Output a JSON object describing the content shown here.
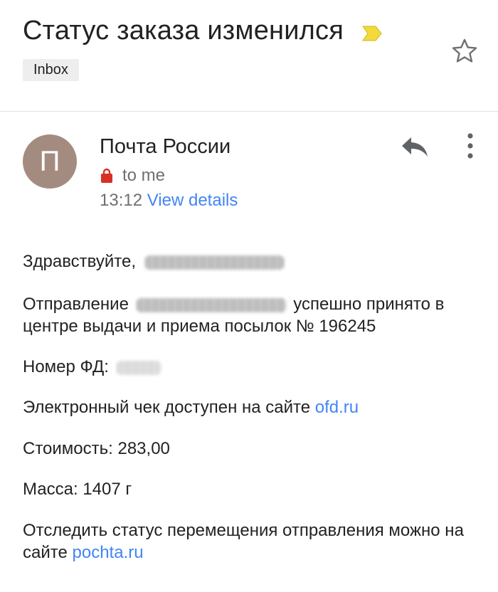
{
  "header": {
    "subject": "Статус заказа изменился",
    "label": "Inbox",
    "icons": {
      "importance": "importance-marker-icon",
      "star": "star-icon"
    },
    "colors": {
      "importance": "#f4d93b"
    }
  },
  "message": {
    "sender_name": "Почта России",
    "avatar_letter": "П",
    "avatar_color": "#a48b80",
    "recipient": "to me",
    "time": "13:12",
    "view_details": "View details",
    "icons": {
      "security": "lock-icon",
      "reply": "reply-icon",
      "more": "more-vert-icon"
    }
  },
  "body": {
    "greeting": "Здравствуйте,",
    "shipment_prefix": "Отправление",
    "shipment_suffix": "успешно принято в центре выдачи и приема посылок № 196245",
    "fd_label": "Номер ФД:",
    "receipt_text": "Электронный чек доступен на сайте",
    "receipt_link": "ofd.ru",
    "cost": "Стоимость: 283,00",
    "weight": "Масса: 1407 г",
    "tracking_text": "Отследить статус перемещения отправления можно на сайте",
    "tracking_link": "pochta.ru"
  }
}
